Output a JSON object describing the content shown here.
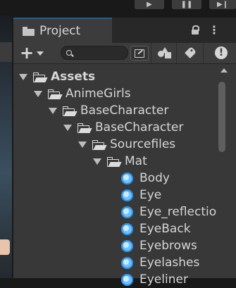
{
  "playbar": {
    "buttons": [
      {
        "name": "play-button",
        "glyph": "▶"
      },
      {
        "name": "pause-button",
        "glyph": "❚❚"
      },
      {
        "name": "step-button",
        "glyph": "▶❙"
      }
    ]
  },
  "project_tab": {
    "title": "Project",
    "icon": "folder-icon",
    "lock_icon": "lock-icon",
    "menu_icon": "kebab-menu-icon"
  },
  "toolbar": {
    "add_button_label": "+",
    "search": {
      "value": "",
      "placeholder": ""
    },
    "icons": [
      "search-icon",
      "search-mode-icon",
      "filter-by-type-icon",
      "filter-by-label-icon",
      "errors-icon"
    ]
  },
  "tree": [
    {
      "label": "Assets",
      "level": 0,
      "type": "folder",
      "expanded": true,
      "bold": true
    },
    {
      "label": "AnimeGirls",
      "level": 1,
      "type": "folder",
      "expanded": true
    },
    {
      "label": "BaseCharacter",
      "level": 2,
      "type": "folder",
      "expanded": true
    },
    {
      "label": "BaseCharacter",
      "level": 3,
      "type": "folder",
      "expanded": true
    },
    {
      "label": "Sourcefiles",
      "level": 4,
      "type": "folder",
      "expanded": true
    },
    {
      "label": "Mat",
      "level": 5,
      "type": "folder",
      "expanded": true
    },
    {
      "label": "Body",
      "level": 6,
      "type": "material"
    },
    {
      "label": "Eye",
      "level": 6,
      "type": "material"
    },
    {
      "label": "Eye_reflectio",
      "level": 6,
      "type": "material"
    },
    {
      "label": "EyeBack",
      "level": 6,
      "type": "material"
    },
    {
      "label": "Eyebrows",
      "level": 6,
      "type": "material"
    },
    {
      "label": "Eyelashes",
      "level": 6,
      "type": "material"
    },
    {
      "label": "Eyeliner",
      "level": 6,
      "type": "material"
    }
  ],
  "colors": {
    "tab_highlight": "#2c5d87",
    "material_icon": "#6fc2ff",
    "panel_bg": "#383838"
  }
}
